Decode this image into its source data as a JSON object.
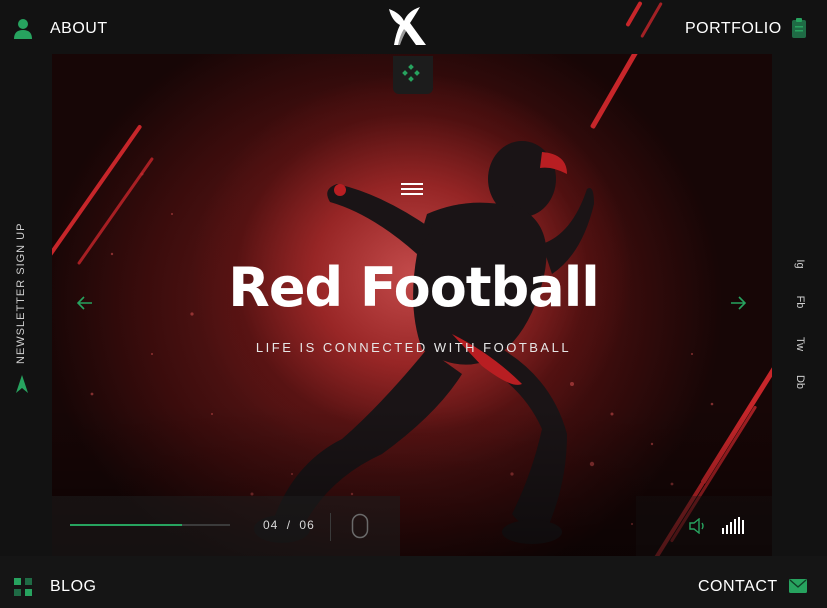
{
  "nav": {
    "about": "ABOUT",
    "portfolio": "PORTFOLIO",
    "blog": "BLOG",
    "contact": "CONTACT"
  },
  "hero": {
    "title": "Red Football",
    "subtitle": "LIFE IS CONNECTED WITH FOOTBALL"
  },
  "sidebar": {
    "newsletter": "NEWSLETTER SIGN UP"
  },
  "social": [
    "Ig",
    "Fb",
    "Tw",
    "Db"
  ],
  "slider": {
    "current": "04",
    "separator": "/",
    "total": "06",
    "progress": 0.7
  },
  "icons": {
    "about": "user-icon",
    "portfolio": "clipboard-icon",
    "blog": "grid-icon",
    "contact": "mail-icon",
    "logo": "bird-logo",
    "menu": "menu-icon",
    "prev": "arrow-left-icon",
    "next": "arrow-right-icon",
    "sound": "volume-icon",
    "equalizer": "equalizer-icon",
    "mouse": "mouse-scroll-icon",
    "newsletter": "paper-plane-icon"
  },
  "colors": {
    "accent": "#27a35f",
    "red": "#c7262a",
    "background": "#121212"
  }
}
